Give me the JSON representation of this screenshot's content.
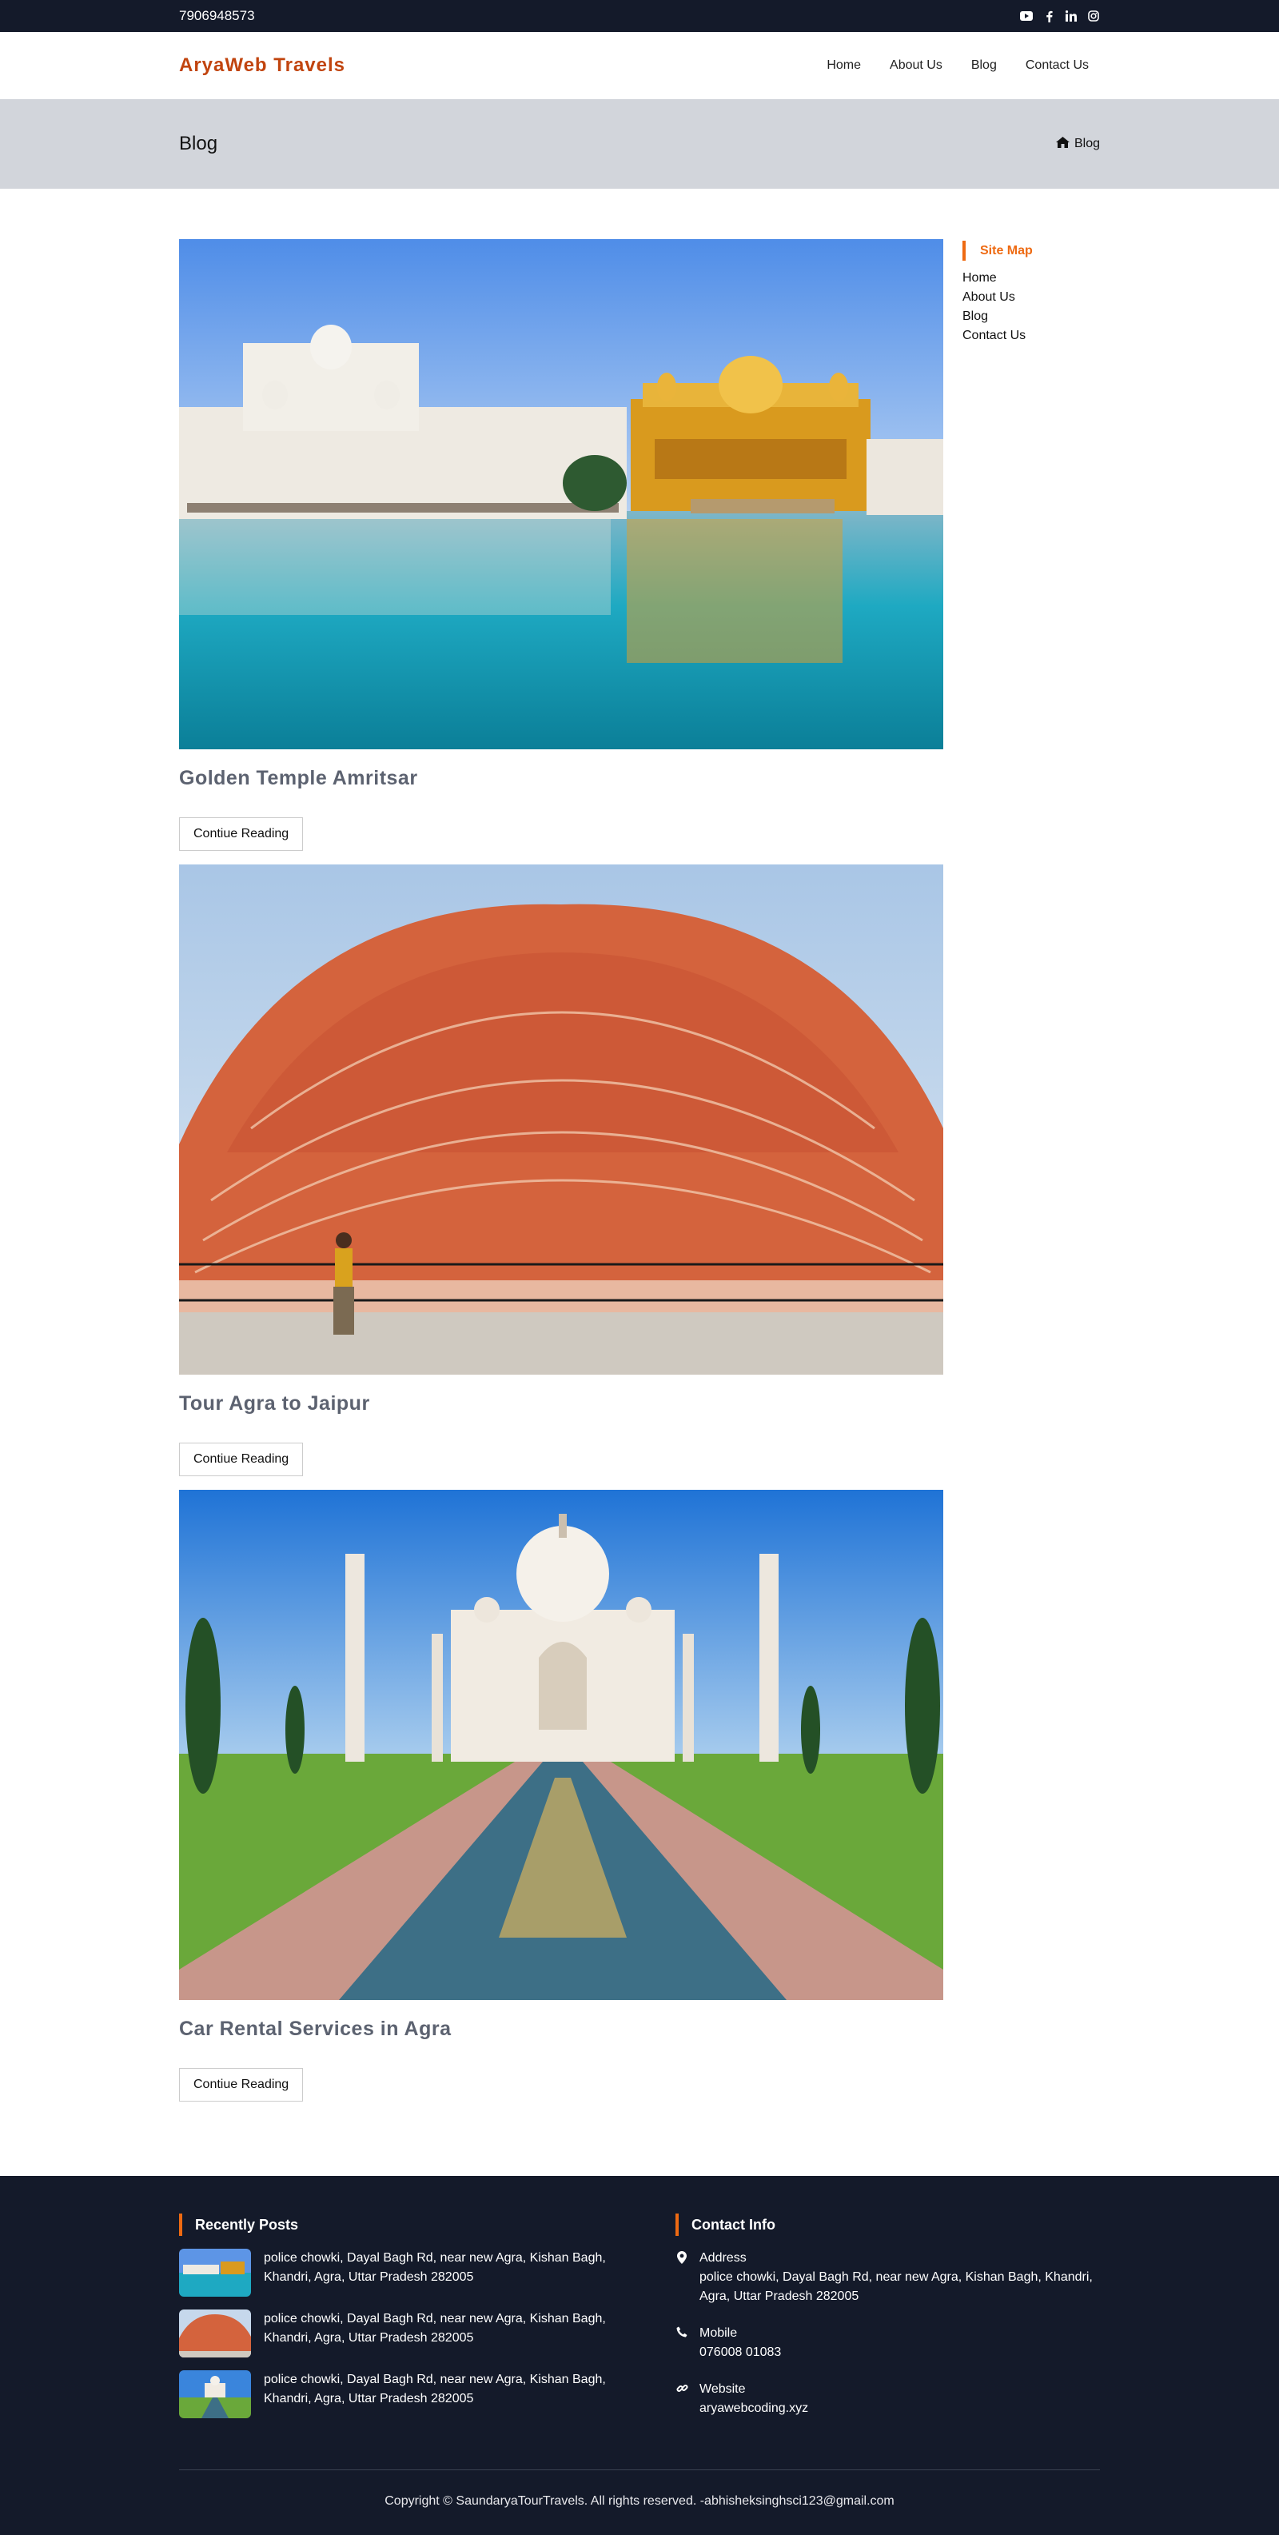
{
  "topbar": {
    "phone": "7906948573",
    "social_icons": [
      "youtube-icon",
      "facebook-icon",
      "linkedin-icon",
      "instagram-icon"
    ]
  },
  "header": {
    "brand": "AryaWeb Travels",
    "nav": [
      "Home",
      "About Us",
      "Blog",
      "Contact Us"
    ]
  },
  "banner": {
    "title": "Blog",
    "breadcrumb": "Blog"
  },
  "posts": [
    {
      "title": "Golden Temple Amritsar",
      "button": "Contiue Reading",
      "image": "golden-temple-photo"
    },
    {
      "title": "Tour Agra to Jaipur",
      "button": "Contiue Reading",
      "image": "hawa-mahal-photo"
    },
    {
      "title": "Car Rental Services in Agra",
      "button": "Contiue Reading",
      "image": "taj-mahal-photo"
    }
  ],
  "sidebar": {
    "title": "Site Map",
    "links": [
      "Home",
      "About Us",
      "Blog",
      "Contact Us"
    ]
  },
  "footer": {
    "recent_title": "Recently Posts",
    "recent": [
      "police chowki, Dayal Bagh Rd, near new Agra, Kishan Bagh, Khandri, Agra, Uttar Pradesh 282005",
      "police chowki, Dayal Bagh Rd, near new Agra, Kishan Bagh, Khandri, Agra, Uttar Pradesh 282005",
      "police chowki, Dayal Bagh Rd, near new Agra, Kishan Bagh, Khandri, Agra, Uttar Pradesh 282005"
    ],
    "contact_title": "Contact Info",
    "address_label": "Address",
    "address": "police chowki, Dayal Bagh Rd, near new Agra, Kishan Bagh, Khandri, Agra, Uttar Pradesh 282005",
    "mobile_label": "Mobile",
    "mobile": "076008 01083",
    "website_label": "Website",
    "website": "aryawebcoding.xyz",
    "copyright": "Copyright © SaundaryaTourTravels. All rights reserved. -abhisheksinghsci123@gmail.com"
  },
  "colors": {
    "accent": "#ee6a12",
    "brand": "#c1440e",
    "dark": "#141a2a",
    "banner": "#d2d5db"
  }
}
